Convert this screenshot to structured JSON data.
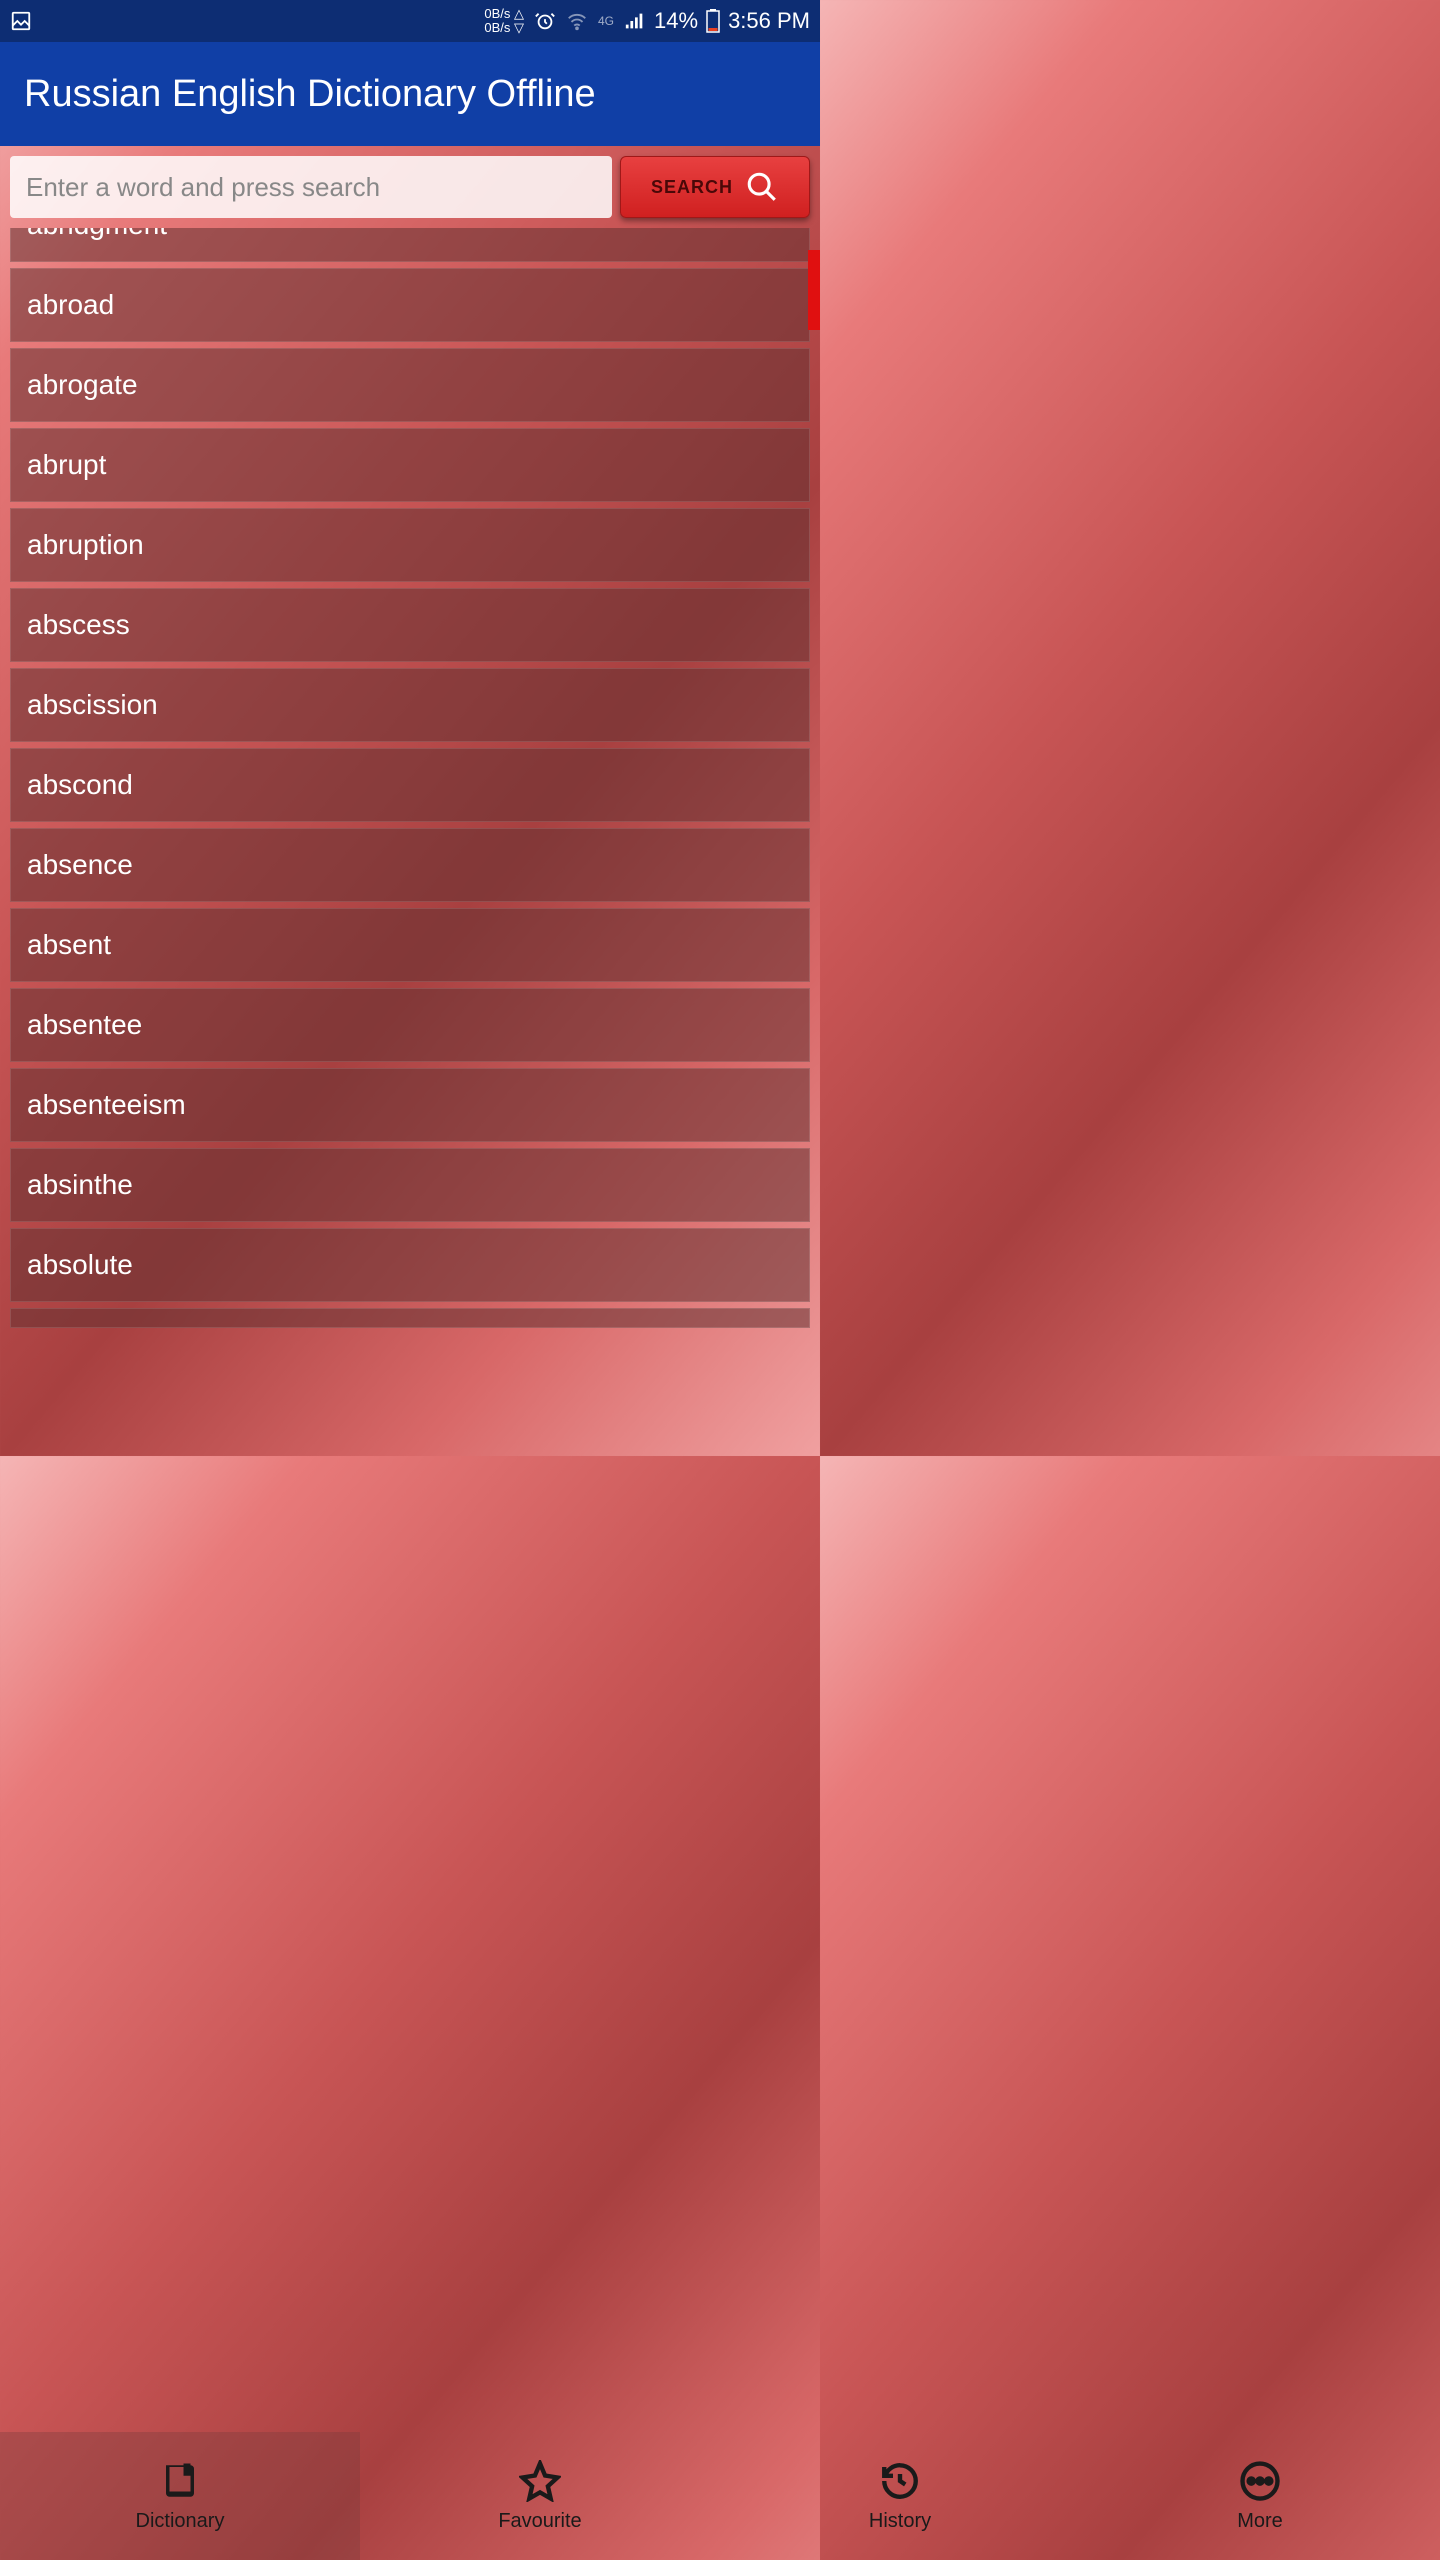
{
  "status": {
    "net_up": "0B/s △",
    "net_down": "0B/s ▽",
    "fourg": "4G",
    "battery_pct": "14%",
    "time": "3:56 PM"
  },
  "app": {
    "title": "Russian English Dictionary Offline"
  },
  "search": {
    "placeholder": "Enter a word and press search",
    "button_label": "SEARCH"
  },
  "words": [
    "abridgment",
    "abroad",
    "abrogate",
    "abrupt",
    "abruption",
    "abscess",
    "abscission",
    "abscond",
    "absence",
    "absent",
    "absentee",
    "absenteeism",
    "absinthe",
    "absolute"
  ],
  "nav": {
    "dictionary": "Dictionary",
    "favourite": "Favourite",
    "history": "History",
    "more": "More"
  }
}
